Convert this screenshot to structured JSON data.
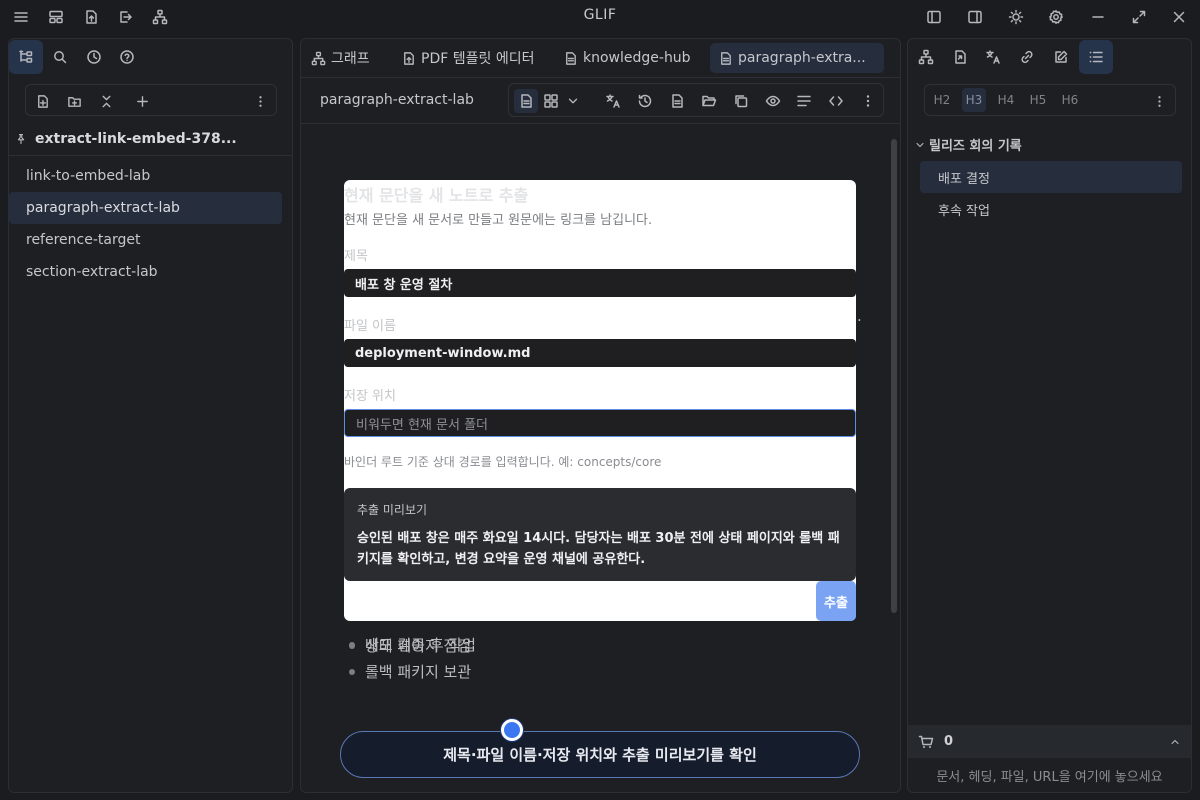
{
  "app": {
    "title": "GLIF"
  },
  "left_sidebar": {
    "vault_name": "extract-link-embed-378...",
    "files": [
      {
        "label": "link-to-embed-lab",
        "active": false
      },
      {
        "label": "paragraph-extract-lab",
        "active": true
      },
      {
        "label": "reference-target",
        "active": false
      },
      {
        "label": "section-extract-lab",
        "active": false
      }
    ]
  },
  "tabs": [
    {
      "label": "그래프",
      "icon": "graph-icon"
    },
    {
      "label": "PDF 템플릿 에디터",
      "icon": "pdf-template-icon"
    },
    {
      "label": "knowledge-hub",
      "icon": "document-icon"
    },
    {
      "label": "paragraph-extra...",
      "icon": "document-icon",
      "active": true
    }
  ],
  "editor": {
    "doc_title": "paragraph-extract-lab",
    "bullets": [
      "상태 페이지 점검",
      "롤백 패키지 보관"
    ],
    "partial_char": "."
  },
  "modal": {
    "title": "현재 문단을 새 노트로 추출",
    "description": "현재 문단을 새 문서로 만들고 원문에는 링크를 남깁니다.",
    "title_label": "제목",
    "title_value": "배포 창 운영 절차",
    "filename_label": "파일 이름",
    "filename_value": "deployment-window.md",
    "location_label": "저장 위치",
    "location_placeholder": "비워두면 현재 문서 폴더",
    "location_hint": "바인더 루트 기준 상대 경로를 입력합니다. 예: concepts/core",
    "preview_label": "추출 미리보기",
    "preview_text": "승인된 배포 창은 매주 화요일 14시다. 담당자는 배포 30분 전에 상태 페이지와 롤백 패키지를 확인하고, 변경 요약을 운영 채널에 공유한다.",
    "extract_button": "추출"
  },
  "cta": {
    "label": "제목·파일 이름·저장 위치와 추출 미리보기를 확인"
  },
  "right_sidebar": {
    "heading_levels": [
      "H2",
      "H3",
      "H4",
      "H5",
      "H6"
    ],
    "active_heading_level": "H3",
    "outline_group": "릴리즈 회의 기록",
    "outline_items": [
      {
        "label": "배포 결정",
        "active": true
      },
      {
        "label": "후속 작업",
        "active": false
      }
    ],
    "basket_count": "0",
    "drop_hint": "문서, 헤딩, 파일, URL을 여기에 놓으세요"
  }
}
